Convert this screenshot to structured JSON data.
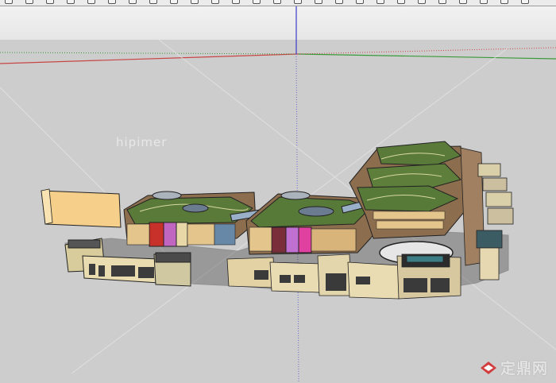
{
  "app": {
    "toolbar_icons": [
      "select-tool-icon",
      "eraser-icon",
      "paint-icon",
      "pencil-icon",
      "arc-icon",
      "rectangle-icon",
      "circle-icon",
      "polygon-icon",
      "move-icon",
      "push-pull-icon",
      "rotate-icon",
      "follow-me-icon",
      "scale-icon",
      "offset-icon",
      "tape-icon",
      "dimension-icon",
      "protractor-icon",
      "text-icon",
      "axes-icon",
      "orbit-icon",
      "pan-icon",
      "zoom-icon",
      "zoom-window-icon",
      "zoom-extents-icon",
      "previous-icon",
      "next-icon"
    ],
    "axis_colors": {
      "red": "#c84646",
      "green": "#3a9a3a",
      "blue": "#4646c8"
    }
  },
  "viewport": {
    "watermark_text": "hipimer",
    "sky_color": "#ebebeb",
    "ground_color": "#cdcdcd"
  },
  "brand": {
    "text": "定鼎网",
    "logo_color": "#d23c3c"
  }
}
